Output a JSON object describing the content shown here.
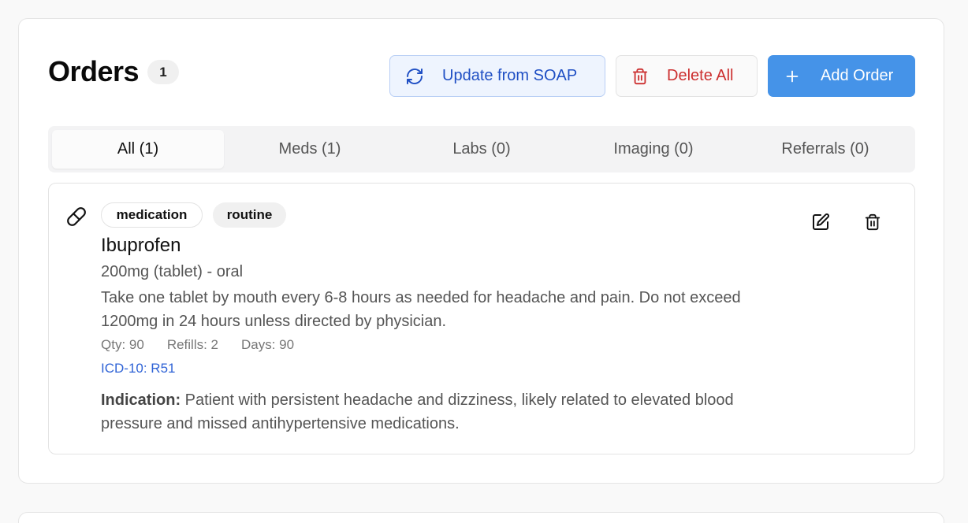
{
  "header": {
    "title": "Orders",
    "count": "1"
  },
  "actions": {
    "update_label": "Update from SOAP",
    "delete_all_label": "Delete All",
    "add_label": "Add Order"
  },
  "tabs": [
    {
      "label": "All (1)",
      "active": true
    },
    {
      "label": "Meds (1)",
      "active": false
    },
    {
      "label": "Labs (0)",
      "active": false
    },
    {
      "label": "Imaging (0)",
      "active": false
    },
    {
      "label": "Referrals (0)",
      "active": false
    }
  ],
  "order": {
    "icon": "pill-icon",
    "tags": [
      "medication",
      "routine"
    ],
    "name": "Ibuprofen",
    "dose": "200mg (tablet) - oral",
    "instructions": "Take one tablet by mouth every 6-8 hours as needed for headache and pain. Do not exceed 1200mg in 24 hours unless directed by physician.",
    "qty": "Qty: 90",
    "refills": "Refills: 2",
    "days": "Days: 90",
    "icd": "ICD-10: R51",
    "indication_label": "Indication:",
    "indication_text": " Patient with persistent headache and dizziness, likely related to elevated blood pressure and missed antihypertensive medications."
  },
  "colors": {
    "primary": "#4593e8",
    "danger": "#cc2f2f",
    "link": "#2f63d6"
  }
}
